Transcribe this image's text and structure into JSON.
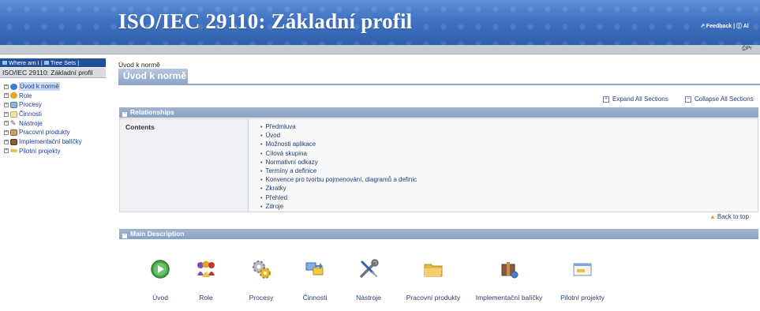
{
  "header": {
    "title": "ISO/IEC 29110: Základní profil",
    "feedback_label": "Feedback",
    "separator": "|",
    "extra_link": "Al",
    "print_label": "Pr",
    "brand_color": "#3f73c2"
  },
  "nav": {
    "toolbar_where": "Where am I",
    "toolbar_sep": "|",
    "toolbar_tree": "Tree Sets",
    "breadcrumb": "ISO/IEC 29110: Základní profil",
    "items": [
      {
        "label": "Úvod k normě",
        "icon": "intro-icon",
        "selected": true
      },
      {
        "label": "Role",
        "icon": "roles-icon",
        "selected": false
      },
      {
        "label": "Procesy",
        "icon": "process-icon",
        "selected": false
      },
      {
        "label": "Činnosti",
        "icon": "activity-icon",
        "selected": false
      },
      {
        "label": "Nástroje",
        "icon": "tools-icon",
        "selected": false
      },
      {
        "label": "Pracovní produkty",
        "icon": "workproduct-icon",
        "selected": false
      },
      {
        "label": "Implementační balíčky",
        "icon": "package-icon",
        "selected": false
      },
      {
        "label": "Pilotní projekty",
        "icon": "pilot-icon",
        "selected": false
      }
    ]
  },
  "main": {
    "path": "Úvod k normě",
    "tab_label": "Úvod k normě",
    "expand_all": "Expand All Sections",
    "collapse_all": "Collapse All Sections",
    "relationships": {
      "header": "Relationships",
      "label": "Contents",
      "items": [
        "Předmluva",
        "Úvod",
        "Možnosti aplikace",
        "Cílová skupina",
        "Normativní odkazy",
        "Termíny a definice",
        "Konvence pro tvorbu pojmenování, diagramů a definic",
        "Zkratky",
        "Přehled",
        "Zdroje"
      ]
    },
    "back_to_top": "Back to top",
    "main_description": {
      "header": "Main Description",
      "tiles": [
        {
          "label": "Úvod",
          "icon": "play-icon"
        },
        {
          "label": "Role",
          "icon": "roles-icon"
        },
        {
          "label": "Procesy",
          "icon": "gears-icon"
        },
        {
          "label": "Činnosti",
          "icon": "activity-icon"
        },
        {
          "label": "Nástroje",
          "icon": "wrench-screwdriver-icon"
        },
        {
          "label": "Pracovní produkty",
          "icon": "folder-icon"
        },
        {
          "label": "Implementační balíčky",
          "icon": "package-icon"
        },
        {
          "label": "Pilotní projekty",
          "icon": "pilot-icon"
        }
      ]
    }
  }
}
